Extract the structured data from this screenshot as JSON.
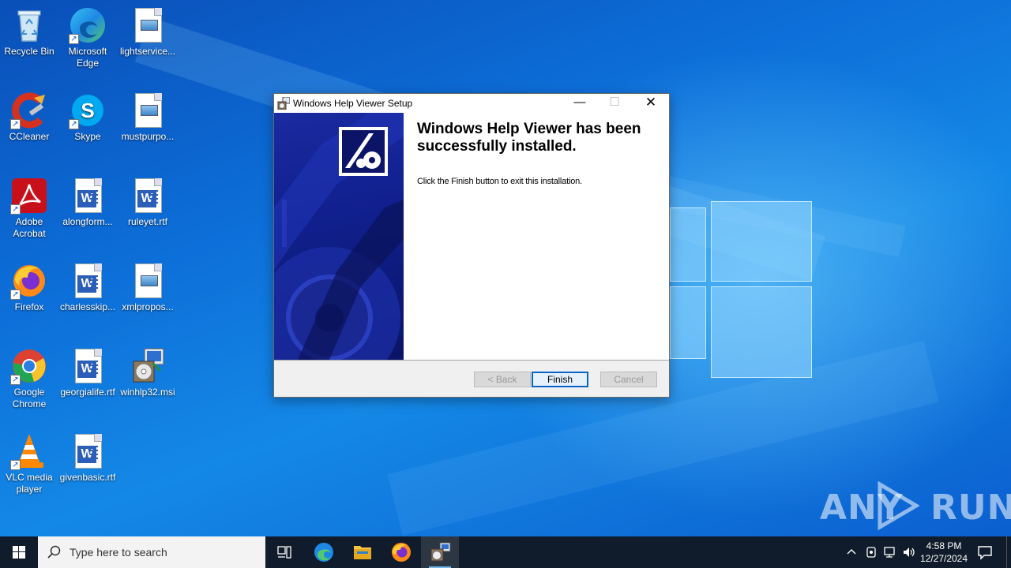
{
  "desktop": {
    "icons": [
      {
        "label": "Recycle Bin"
      },
      {
        "label": "Microsoft Edge"
      },
      {
        "label": "lightservice..."
      },
      {
        "label": "CCleaner"
      },
      {
        "label": "Skype"
      },
      {
        "label": "mustpurpo..."
      },
      {
        "label": "Adobe Acrobat"
      },
      {
        "label": "alongform..."
      },
      {
        "label": "ruleyet.rtf"
      },
      {
        "label": "Firefox"
      },
      {
        "label": "charlesskip..."
      },
      {
        "label": "xmlpropos..."
      },
      {
        "label": "Google Chrome"
      },
      {
        "label": "georgialife.rtf"
      },
      {
        "label": "winhlp32.msi"
      },
      {
        "label": "VLC media player"
      },
      {
        "label": "givenbasic.rtf"
      }
    ]
  },
  "dialog": {
    "title": "Windows Help Viewer Setup",
    "heading": "Windows Help Viewer has been successfully installed.",
    "body": "Click the Finish button to exit this installation.",
    "buttons": {
      "back": "< Back",
      "finish": "Finish",
      "cancel": "Cancel"
    },
    "controls": {
      "minimize": "—",
      "maximize": "☐",
      "close": "✕"
    }
  },
  "taskbar": {
    "search_placeholder": "Type here to search",
    "clock_time": "4:58 PM",
    "clock_date": "12/27/2024"
  },
  "watermark": {
    "left": "ANY",
    "right": "RUN"
  },
  "colors": {
    "taskbar": "#101c2b",
    "banner": "#101f8c",
    "default_button_border": "#0a64c8"
  }
}
